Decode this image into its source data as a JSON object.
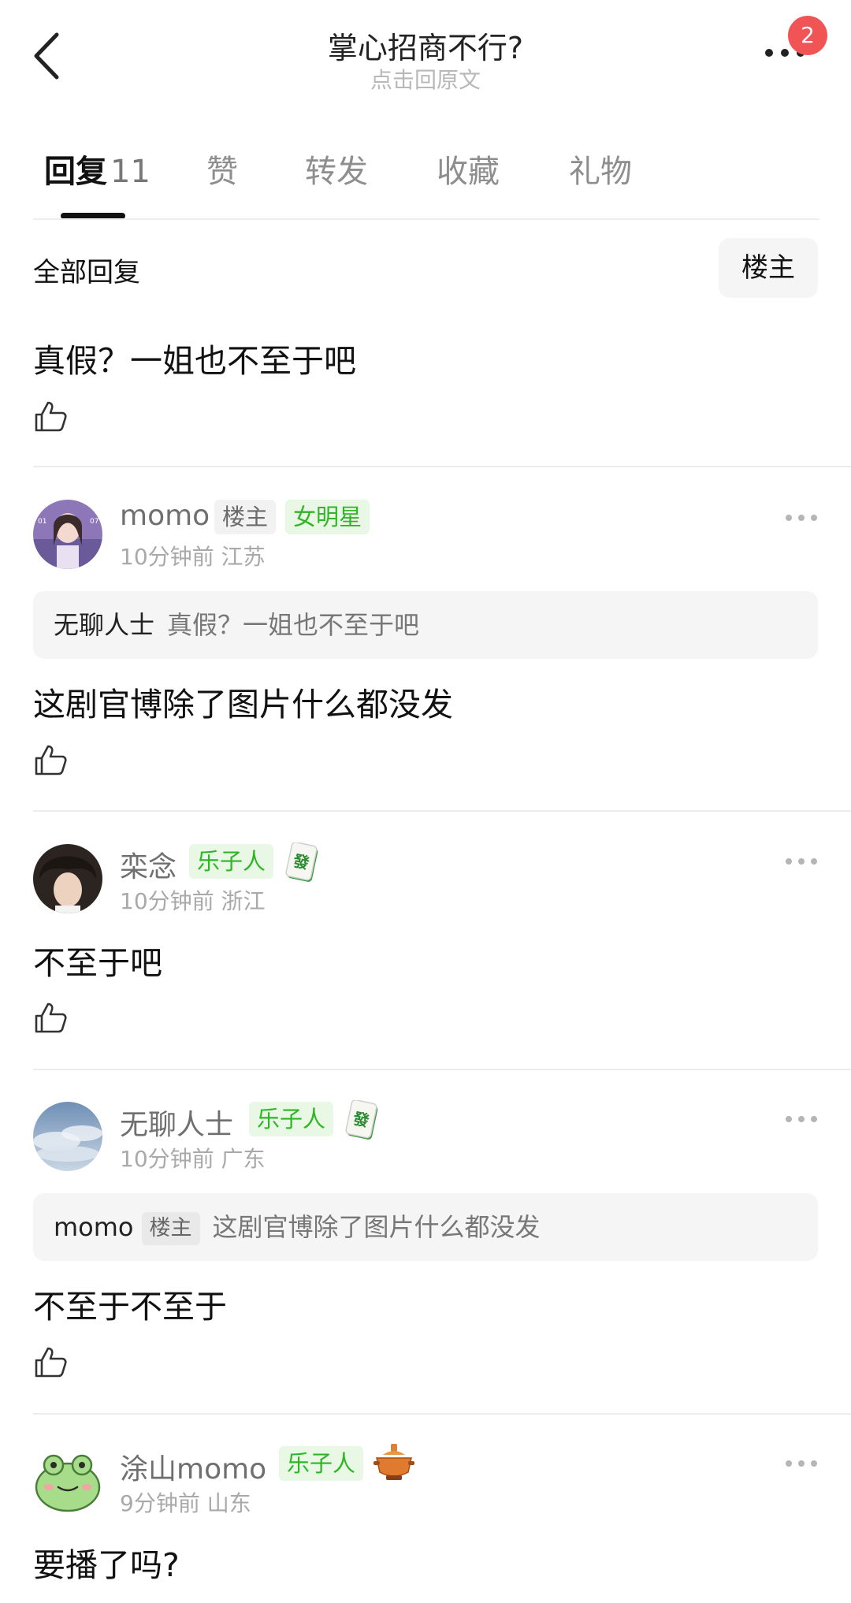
{
  "header": {
    "title": "掌心招商不行?",
    "subtitle": "点击回原文",
    "badge_count": "2"
  },
  "tabs": {
    "replies_label": "回复",
    "replies_count": "11",
    "likes_label": "赞",
    "reposts_label": "转发",
    "favorites_label": "收藏",
    "gifts_label": "礼物"
  },
  "filter": {
    "all_replies_label": "全部回复",
    "op_only_label": "楼主"
  },
  "top_post": {
    "text": "真假？一姐也不至于吧"
  },
  "comments": [
    {
      "username": "momo",
      "op_tag": "楼主",
      "title_tag": "女明星",
      "time": "10分钟前",
      "location": "江苏",
      "quote_user": "无聊人士",
      "quote_text": "真假？一姐也不至于吧",
      "text": "这剧官博除了图片什么都没发"
    },
    {
      "username": "栾念",
      "title_tag": "乐子人",
      "badge_icon": "mahjong-fa-icon",
      "time": "10分钟前",
      "location": "浙江",
      "text": "不至于吧"
    },
    {
      "username": "无聊人士",
      "title_tag": "乐子人",
      "badge_icon": "mahjong-fa-icon",
      "time": "10分钟前",
      "location": "广东",
      "quote_user": "momo",
      "quote_tag": "楼主",
      "quote_text": "这剧官博除了图片什么都没发",
      "text": "不至于不至于"
    },
    {
      "username": "涂山momo",
      "title_tag": "乐子人",
      "badge_icon": "hotpot-icon",
      "time": "9分钟前",
      "location": "山东",
      "text": "要播了吗?"
    }
  ],
  "colors": {
    "accent_green": "#2fb526",
    "badge_red": "#f05455",
    "tag_green_bg": "#e8f8e5"
  }
}
